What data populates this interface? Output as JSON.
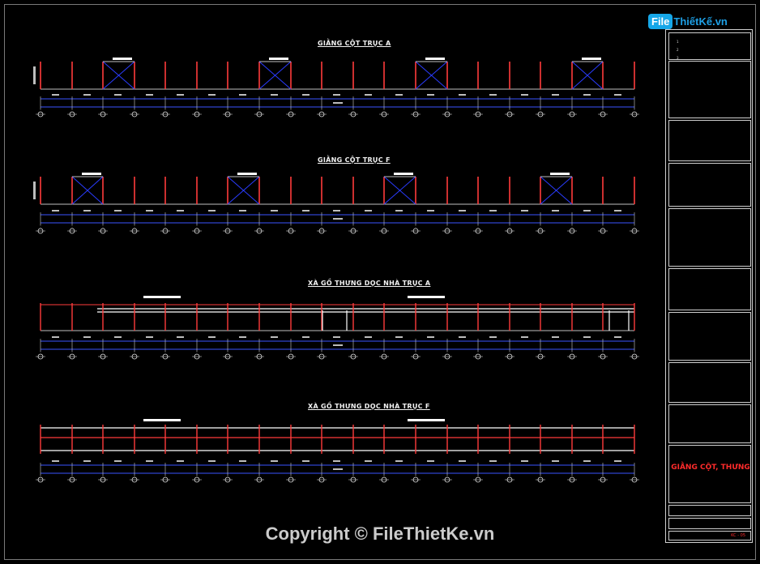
{
  "drawing": {
    "sections": [
      {
        "title": "GIẰNG CỘT TRỤC A"
      },
      {
        "title": "GIẰNG CỘT TRỤC F"
      },
      {
        "title": "XÀ GỒ THƯNG DỌC NHÀ TRỤC A"
      },
      {
        "title": "XÀ GỒ THƯNG DỌC NHÀ TRỤC F"
      }
    ]
  },
  "title_block": {
    "revision_rows": [
      "1",
      "2",
      "3"
    ],
    "sheet_name": "GIẰNG CỘT, THƯNG",
    "sheet_code": "KC - 05"
  },
  "logo": {
    "mark": "File",
    "text": "ThiếtKế.vn"
  },
  "watermark": "Copyright © FileThietKe.vn",
  "colors": {
    "background": "#000000",
    "column": "#ff3b3b",
    "dimension": "#3a55ff",
    "bracing": "#2a3cff",
    "lines": "#ffffff",
    "title_accent": "#ff2b2b",
    "logo": "#16a7e8"
  }
}
